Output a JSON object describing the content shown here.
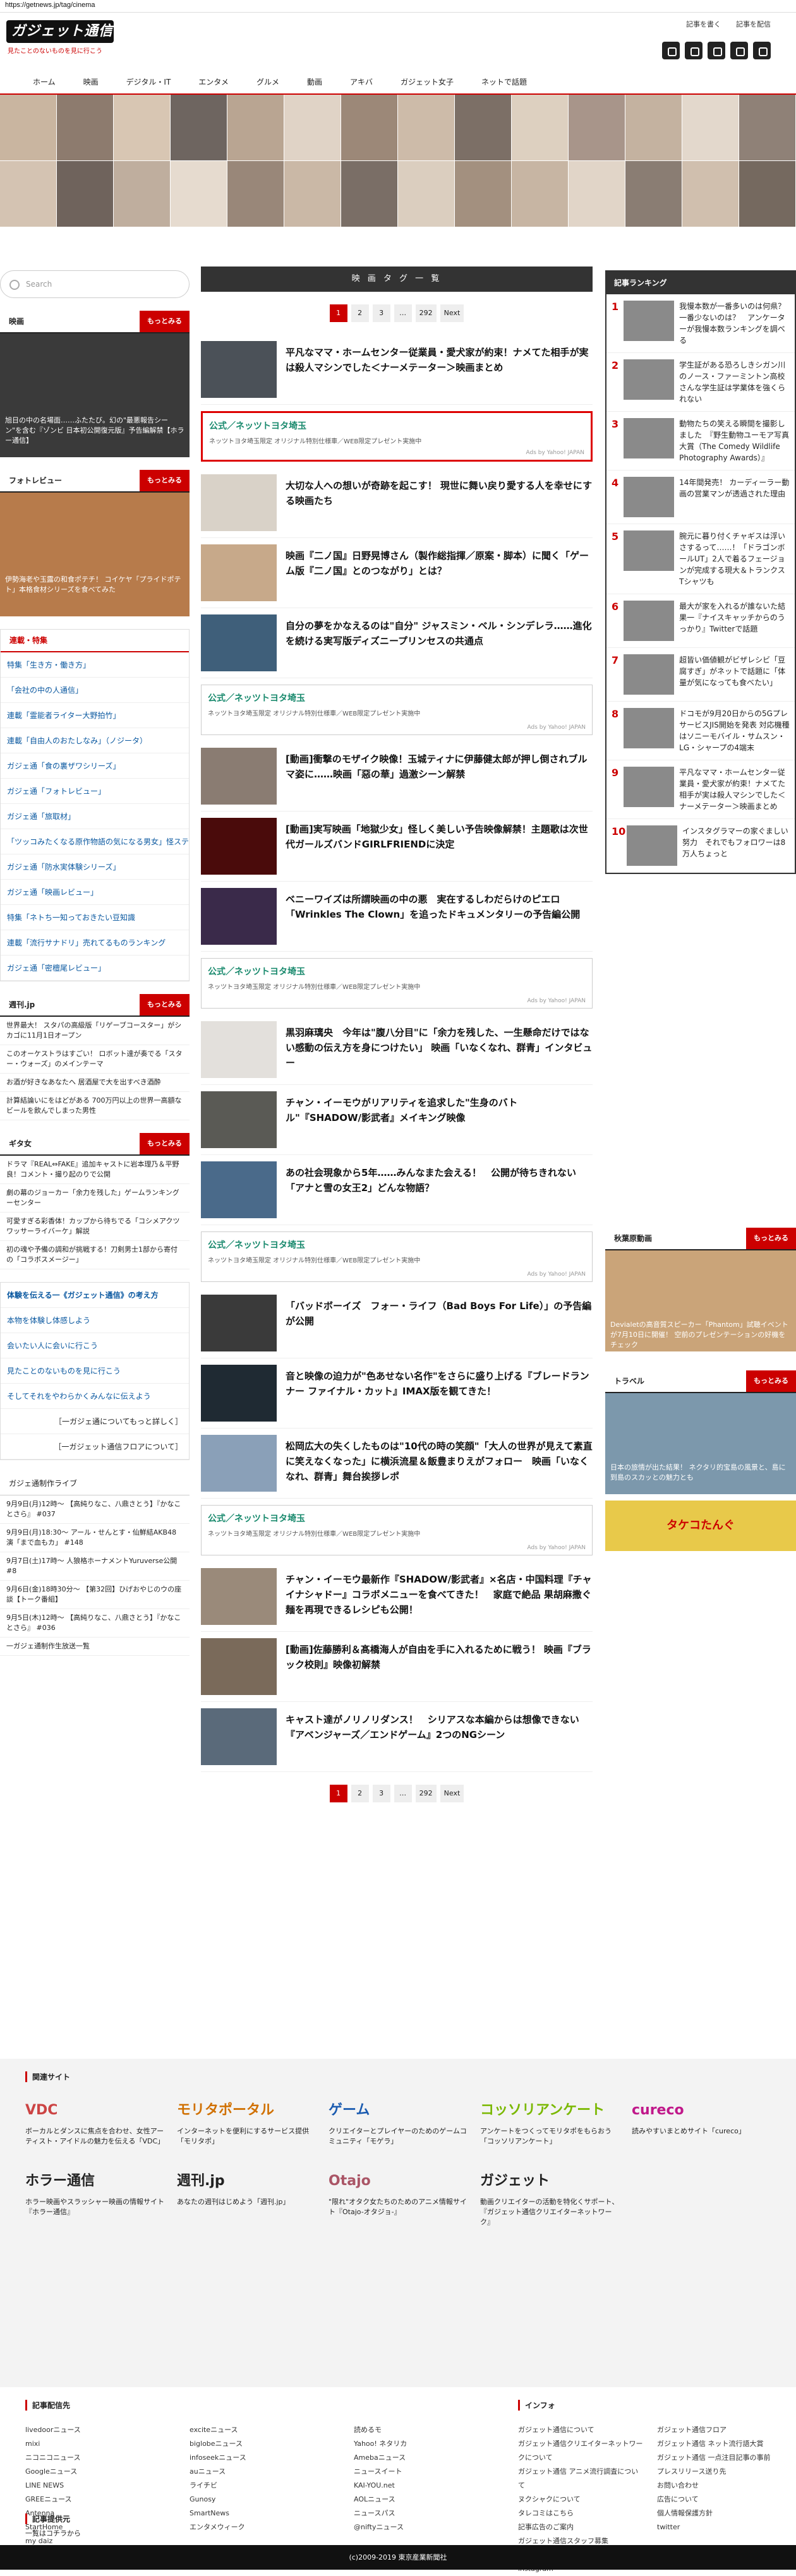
{
  "url": "https://getnews.jp/tag/cinema",
  "header": {
    "logo": "ガジェット通信",
    "tagline": "見たことのないものを見に行こう",
    "links": [
      "記事を書く",
      "記事を配信"
    ]
  },
  "nav": [
    "ホーム",
    "映画",
    "デジタル・IT",
    "エンタメ",
    "グルメ",
    "動画",
    "アキバ",
    "ガジェット女子",
    "ネットで話題"
  ],
  "search": {
    "placeholder": "Search"
  },
  "left": {
    "movie": {
      "title": "映画",
      "more": "もっとみる",
      "caption": "旭日の中の名場面……ふたたび。幻の\"最悪報告シーン\"を含む『ゾンビ 日本初公開復元版』予告編解禁【ホラー通信】"
    },
    "photo": {
      "title": "フォトレビュー",
      "more": "もっとみる",
      "caption": "伊勢海老や玉露の和食ポテチ！ コイケヤ「プライドポテト」本格食材シリーズを食べてみた"
    },
    "tags": {
      "title": "連載・特集",
      "items": [
        "特集「生き方・働き方」",
        "「会社の中の人通信」",
        "連載「霊能者ライター大野拍竹」",
        "連載「自由人のおたしなみ」（ノジータ）",
        "ガジェ通「食の裏ザワシリーズ」",
        "ガジェ通「フォトレビュー」",
        "ガジェ通「旅取材」",
        "「ツッコみたくなる原作物語の気になる男女」怪ステマイ",
        "ガジェ通「防水実体験シリーズ」",
        "ガジェ通「映画レビュー」",
        "特集「ネトち一知っておきたい豆知識",
        "連載「流行サナドリ」売れてるものランキング",
        "ガジェ通「密檀尾レビュー」"
      ]
    },
    "news1": {
      "title": "週刊.jp",
      "more": "もっとみる",
      "items": [
        "世界最大！ スタパの高級版「リゲーブコースター」がシカゴに11月1日オープン",
        "このオーケストラはすごい！ ロボット達が奏でる「スター・ウォーズ」のメインテーマ",
        "お酒が好きなあなたへ 居酒屋で大を出すべき酒酔",
        "計算結論いにをはどがある 700万円以上の世界一高額なビールを飲んでしまった男性"
      ]
    },
    "news2": {
      "title": "ギタ女",
      "more": "もっとみる",
      "items": [
        "ドラマ『REAL⇔FAKE』追加キャストに岩本理乃＆平野良！コメント・撮り起のりで公開",
        "劇の幕のジョーカー「余力を残した」ゲームランキングーセンター",
        "可愛すぎる彩香体！カップから待ちでる「コシメアクツワッサーライバーケ」解説",
        "初の魂や予備の調和が挑戦する！刀剣男士1部から寄付の「コラボスメージー」"
      ]
    },
    "links": [
      "体験を伝える一《ガジェット通信》の考え方",
      "本物を体験し体感しよう",
      "会いたい人に会いに行こう",
      "見たことのないものを見に行こう",
      "そしてそれをやわらかくみんなに伝えよう",
      "［一ガジェ通についてもっと詳しく］",
      "［一ガジェット通信フロアについて］"
    ],
    "live": {
      "title": "ガジェ通制作ライブ",
      "items": [
        "9月9日(月)12時〜 【高純りなこ、八鼎さとう】『かなことさら』 #037",
        "9月9日(月)18:30〜 アール・せんとす・仙鮮結AKB48演「まで血もカ」 #148",
        "9月7日(土)17時〜 人狼格ホーナメントYuruverse公開 #8",
        "9月6日(金)18時30分〜 【第32回】ひげおやじのウの座談【トーク番組】",
        "9月5日(木)12時〜 【高純りなこ、八鼎さとう】『かなことさら』 #036",
        "一ガジェ通制作生放送一覧"
      ]
    }
  },
  "main": {
    "sectionTitle": "映 画 タ グ 一 覧",
    "pager": [
      "1",
      "2",
      "3",
      "…",
      "292",
      "Next"
    ],
    "articles": [
      "平凡なママ・ホームセンター従業員・愛犬家が約束！ナメてた相手が実は殺人マシンでした＜ナーメテーター＞映画まとめ",
      "大切な人への想いが奇跡を起こす！ 現世に舞い戻り愛する人を幸せにする映画たち",
      "映画『二ノ国』日野晃博さん（製作総指揮／原案・脚本）に聞く「ゲーム版『二ノ国』とのつながり」とは？",
      "自分の夢をかなえるのは\"自分\" ジャスミン・ベル・シンデレラ……進化を続ける実写版ディズニープリンセスの共通点",
      "[動画]衝撃のモザイク映像！玉城ティナに伊藤健太郎が押し倒されブルマ姿に……映画「惡の華」過激シーン解禁",
      "[動画]実写映画「地獄少女」怪しく美しい予告映像解禁！主題歌は次世代ガールズバンドGIRLFRIENDに決定",
      "ベニーワイズは所謂映画の中の悪　実在するしわだらけのピエロ「Wrinkles The Clown」を追ったドキュメンタリーの予告編公開",
      "黒羽麻璃央　今年は\"腹八分目\"に「余力を残した、一生懸命だけではない感動の伝え方を身につけたい」 映画「いなくなれ、群青」インタビュー",
      "チャン・イーモウがリアリティを追求した\"生身のバトル\"『SHADOW/影武者』メイキング映像",
      "あの社会現象から5年……みんなまた会える！　公開が待ちきれない「アナと雪の女王2」どんな物語？",
      "「バッドボーイズ　フォー・ライフ（Bad Boys For Life）」の予告編が公開",
      "音と映像の迫力が\"色あせない名作\"をさらに盛り上げる『ブレードランナー ファイナル・カット』IMAX版を観てきた！",
      "松岡広大の失くしたものは\"10代の時の笑顔\"「大人の世界が見えて素直に笑えなくなった」に横浜流星＆飯豊まりえがフォロー　映画「いなくなれ、群青」舞台挨拶レポ",
      "チャン・イーモウ最新作『SHADOW/影武者』×名店・中国料理『チャイナシャドー』コラボメニューを食べてきた！　家庭で絶品 果胡麻撒ぐ麺を再現できるレシピも公開！",
      "[動画]佐藤勝利＆髙橋海人が自由を手に入れるために戦う！ 映画『ブラック校則』映像初解禁",
      "キャスト達がノリノリダンス！　シリアスな本編からは想像できない『アベンジャーズ／エンドゲーム』2つのNGシーン"
    ],
    "ad": {
      "title": "公式／ネッツトヨタ埼玉",
      "text": "ネッツトヨタ埼玉限定 オリジナル特別仕様車／WEB限定プレゼント実施中",
      "by": "Ads by Yahoo! JAPAN"
    }
  },
  "right": {
    "rankTitle": "記事ランキング",
    "ranking": [
      "我慢本数が一番多いのは何県？　一番少ないのは？　アンケーターが我慢本数ランキングを調べる",
      "学生証がある恐ろしきシガン川のノース・ファーミントン高校　さんな学生証は学業体を強くられない",
      "動物たちの笑える瞬間を撮影しました　『野生動物ユーモア写真大賞（The Comedy Wildlife Photography Awards）』",
      "14年間発売！ カーディーラー動画の営業マンが透過された理由",
      "腕元に暮り付くチャギスは浮いさするって……！「ドラゴンボールUT」2人で着るフェージョンが完成する現大＆トランクスTシャツも",
      "最大が家を入れるが誰ないた結果一『ナイスキャッチからのうっかり』Twitterで話題",
      "超皆い価値観がビザレシビ「豆腐すぎ」がネットで話題に「体量が気になっても食べたい」",
      "ドコモが9月20日からの5GプレサービスJIS開始を発表 対応機種はソニーモバイル・サムスン・LG・シャープの4端末",
      "平凡なママ・ホームセンター従業員・愛犬家が約束！ナメてた相手が実は殺人マシンでした＜ナーメテーター＞映画まとめ",
      "インスタグラマーの家ぐましい努力　それでもフォロワーは8万人ちょっと"
    ],
    "sec1": {
      "title": "秋葉原動画",
      "more": "もっとみる",
      "caption": "Devialetの高音質スピーカー「Phantom」試聴イベントが7月10日に開催！ 空前のプレゼンテーションの好機をチェック"
    },
    "sec2": {
      "title": "トラベル",
      "more": "もっとみる",
      "caption": "日本の旅情が出た結果！ ネクタリ的宝島の風景と、島に到島のスカッとの魅力とも"
    },
    "banner": "タケコたんぐ"
  },
  "related": {
    "title": "関連サイト",
    "sites": [
      {
        "name": "VDC",
        "desc": "ボーカルとダンスに焦点を合わせ、女性アーティスト・アイドルの魅力を伝える「VDC」"
      },
      {
        "name": "モリタポータル",
        "desc": "インターネットを便利にするサービス提供「モリタポ」"
      },
      {
        "name": "ゲーム",
        "desc": "クリエイターとプレイヤーのためのゲームコミュニティ「モゲラ」"
      },
      {
        "name": "コッソリアンケート",
        "desc": "アンケートをつくってモリタポをもらおう「コッソリアンケート」"
      },
      {
        "name": "cureco",
        "desc": "読みやすいまとめサイト「cureco」"
      },
      {
        "name": "ホラー通信",
        "desc": "ホラー映画やスラッシャー映画の情報サイト『ホラー通信』"
      },
      {
        "name": "週刊.jp",
        "desc": "あなたの週刊はじめよう「週刊.jp」"
      },
      {
        "name": "Otajo",
        "desc": "\"限れ\"オタク女たちのためのアニメ情報サイト『Otajo-オタジョ-』"
      },
      {
        "name": "ガジェット",
        "desc": "動画クリエイターの活動を特化くサポート、『ガジェット通信クリエイターネットワーク』"
      }
    ]
  },
  "footer": {
    "distTitle": "記事配信先",
    "dist": [
      [
        "livedoorニュース",
        "mixi",
        "ニコニコニュース",
        "Googleニュース",
        "LINE NEWS",
        "GREEニュース",
        "Antenna",
        "StartHome",
        "my daiz"
      ],
      [
        "exciteニュース",
        "biglobeニュース",
        "infoseekニュース",
        "auニュース",
        "ライチビ",
        "Gunosy",
        "SmartNews",
        "エンタメウィーク"
      ],
      [
        "読めるモ",
        "Yahoo! ネタリカ",
        "Amebaニュース",
        "ニュースイート",
        "KAI-YOU.net",
        "AOLニュース",
        "ニュースパス",
        "@niftyニュース"
      ]
    ],
    "infoTitle": "インフォ",
    "info": [
      [
        "ガジェット通信について",
        "ガジェット通信クリエイターネットワークについて",
        "ガジェット通信 アニメ流行調査について",
        "ヌクシャクについて",
        "タレコミはこちら",
        "記事広告のご案内",
        "ガジェット通信スタッフ募集",
        "facebook",
        "instagram"
      ],
      [
        "ガジェット通信フロア",
        "ガジェット通信 ネット流行語大賞",
        "ガジェット通信 一点注目記事の事前",
        "プレスリリース送り先",
        "お問い合わせ",
        "広告について",
        "個人情報保護方針",
        "twitter"
      ]
    ],
    "provTitle": "記事提供元",
    "prov": "一覧はコチラから",
    "copyright": "(c)2009-2019 東京産業新聞社"
  }
}
